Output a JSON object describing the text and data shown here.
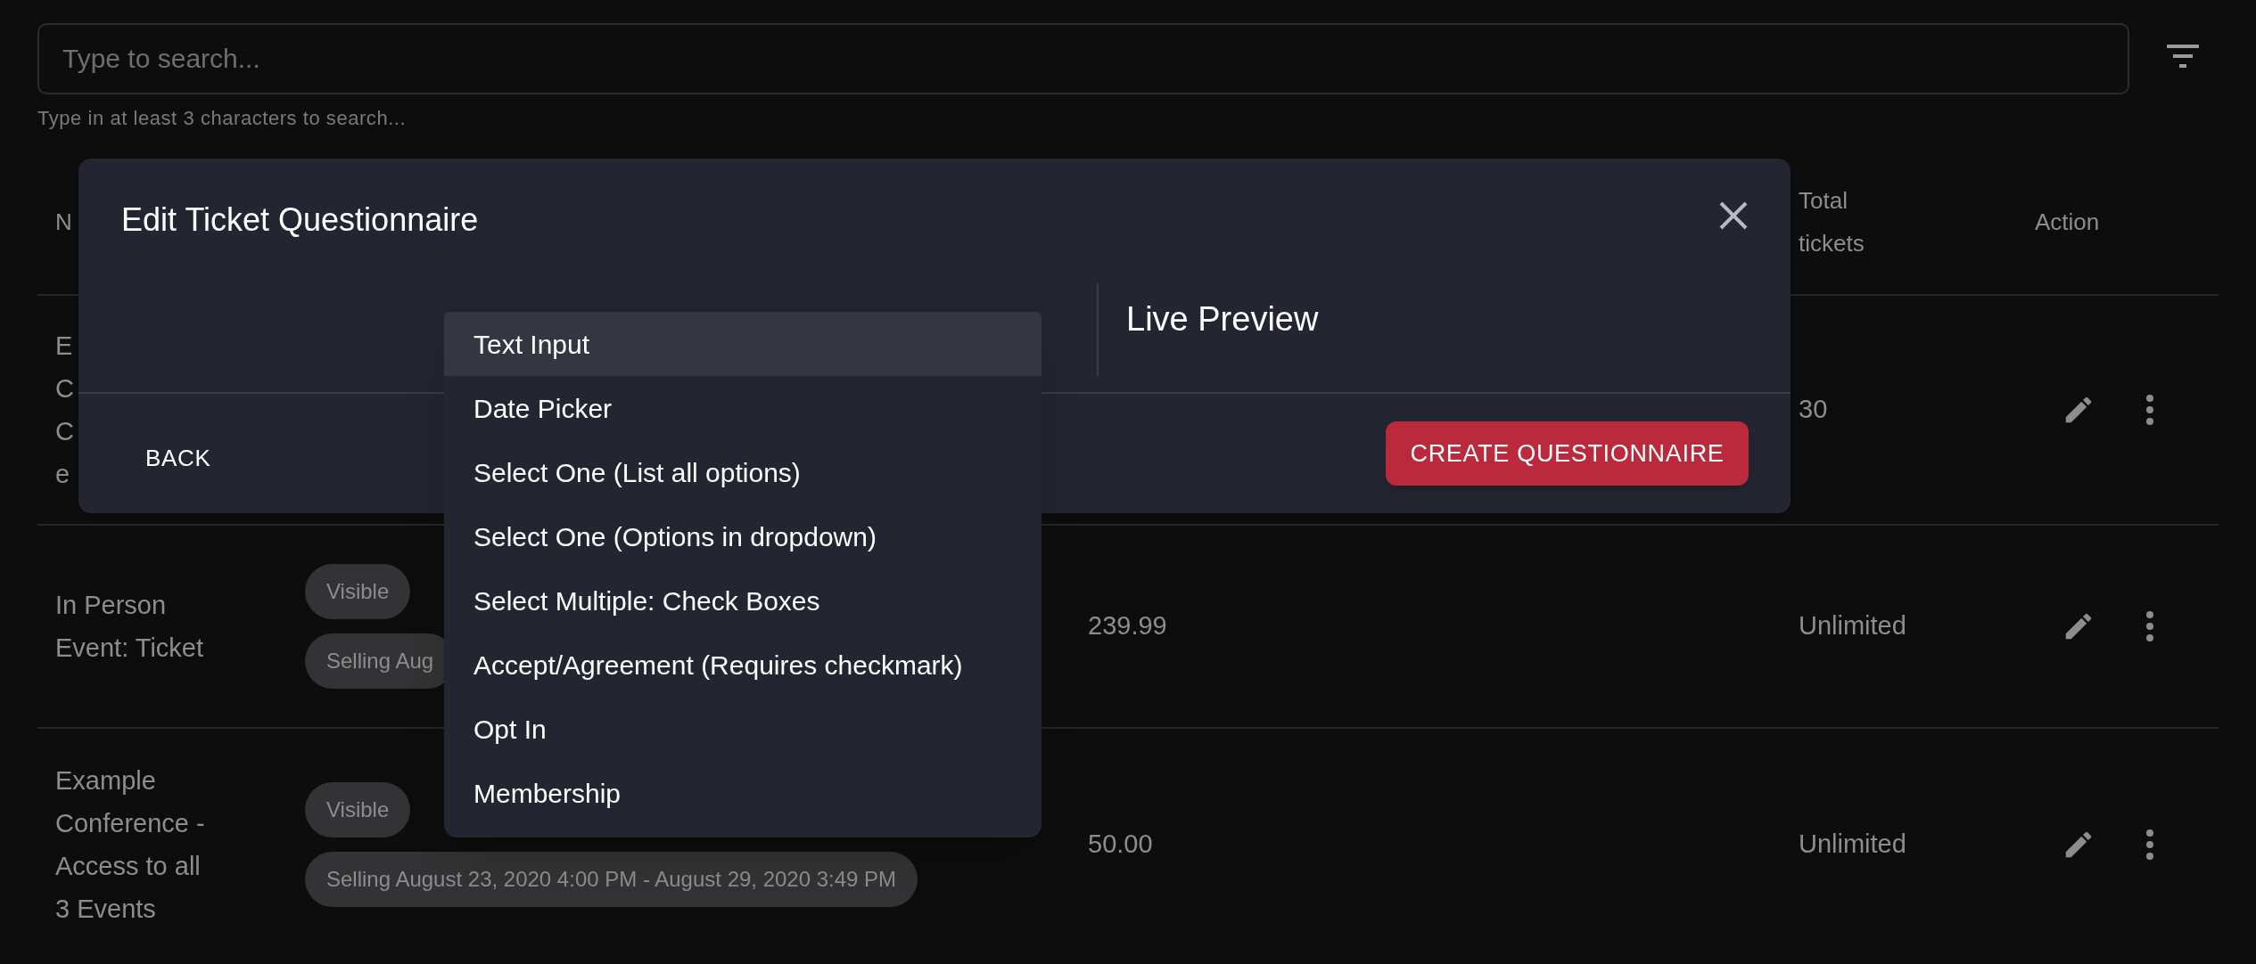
{
  "search": {
    "placeholder": "Type to search...",
    "helper": "Type in at least 3 characters to search..."
  },
  "table": {
    "columns": [
      "N",
      "",
      "",
      "Total tickets",
      "Action"
    ],
    "rows": [
      {
        "name_lines": [
          "E",
          "C",
          "C",
          "e"
        ],
        "chips": [],
        "price": "",
        "total": "30"
      },
      {
        "name_lines": [
          "In Person",
          "Event: Ticket"
        ],
        "chips": [
          "Visible",
          "Selling Aug"
        ],
        "price": "239.99",
        "total": "Unlimited"
      },
      {
        "name_lines": [
          "Example",
          "Conference -",
          "Access to all",
          "3 Events"
        ],
        "chips": [
          "Visible",
          "Selling August 23, 2020 4:00 PM - August 29, 2020 3:49 PM"
        ],
        "price": "50.00",
        "total": "Unlimited"
      }
    ]
  },
  "dialog": {
    "title": "Edit Ticket Questionnaire",
    "preview_title": "Live Preview",
    "back": "BACK",
    "create": "CREATE QUESTIONNAIRE"
  },
  "menu": [
    {
      "label": "Text Input",
      "selected": true
    },
    {
      "label": "Date Picker",
      "selected": false
    },
    {
      "label": "Select One (List all options)",
      "selected": false
    },
    {
      "label": "Select One (Options in dropdown)",
      "selected": false
    },
    {
      "label": "Select Multiple: Check Boxes",
      "selected": false
    },
    {
      "label": "Accept/Agreement (Requires checkmark)",
      "selected": false
    },
    {
      "label": "Opt In",
      "selected": false
    },
    {
      "label": "Membership",
      "selected": false
    }
  ]
}
